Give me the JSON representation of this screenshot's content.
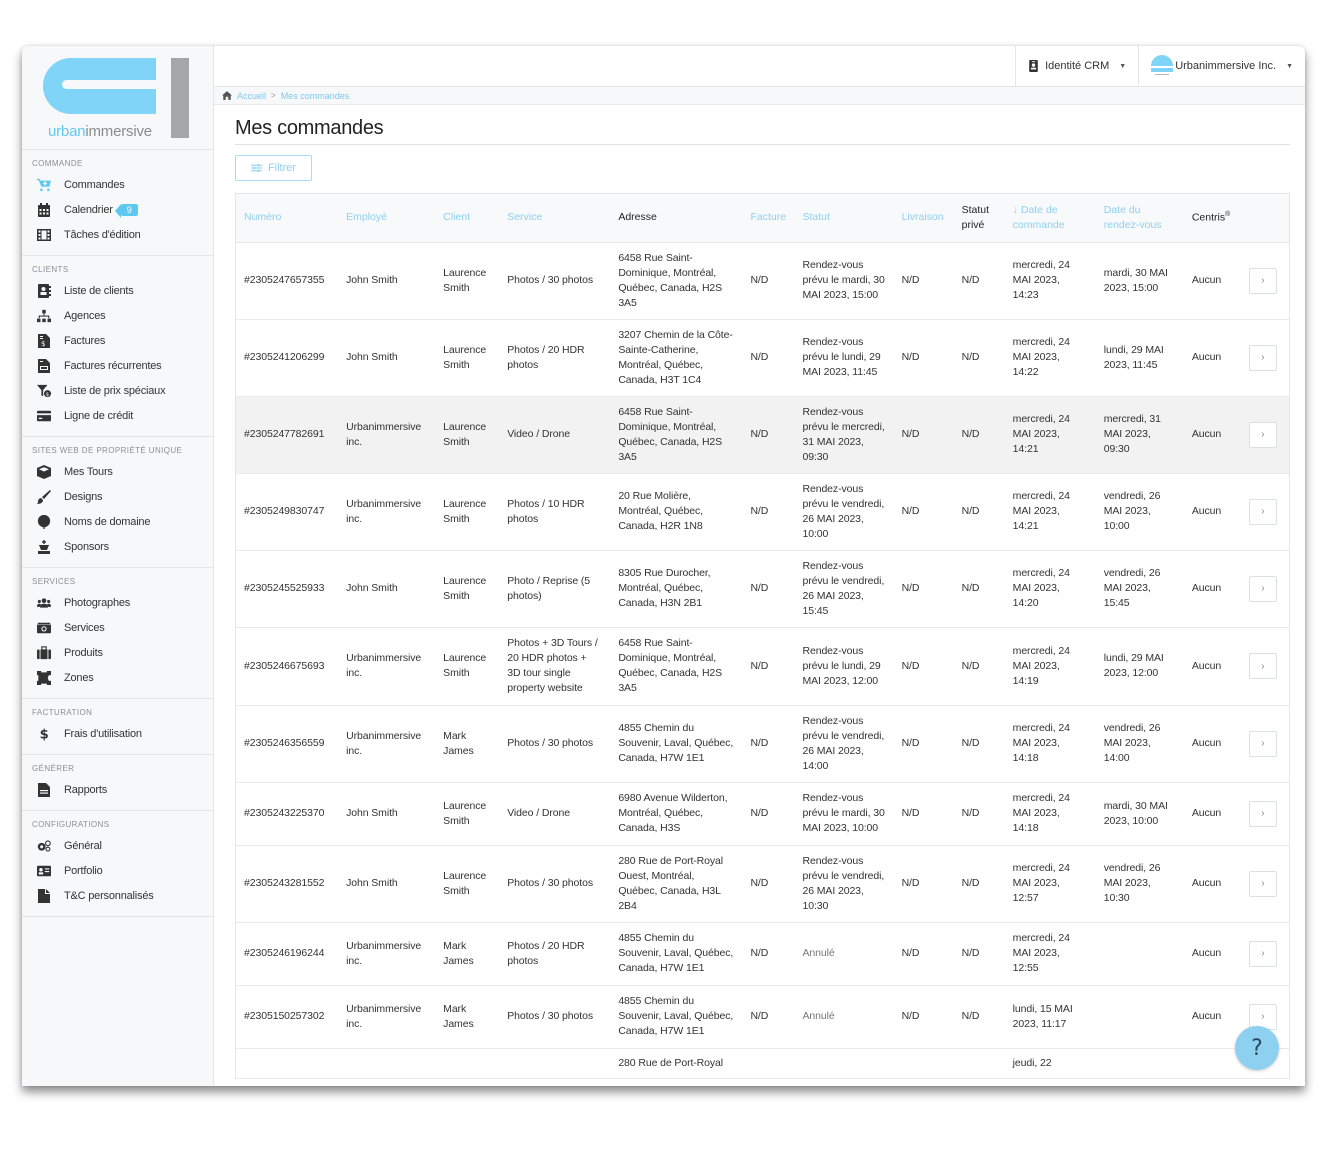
{
  "brand": {
    "word_blue": "urban",
    "word_gray": "immersive"
  },
  "topbar": {
    "crm_label": "Identité CRM",
    "account_label": "Urbanimmersive Inc."
  },
  "breadcrumb": {
    "home": "Accueil",
    "separator": ">",
    "current": "Mes commandes"
  },
  "page": {
    "title": "Mes commandes",
    "filter_label": "Filtrer"
  },
  "colors": {
    "accent": "#5ec8f0",
    "logo_blue": "#7fd4f7",
    "logo_gray": "#a5a6a8",
    "header_link": "#8ed0ef"
  },
  "sidebar": {
    "sections": [
      {
        "title": "Commande",
        "items": [
          {
            "label": "Commandes",
            "icon": "cart-icon",
            "active": true
          },
          {
            "label": "Calendrier",
            "icon": "calendar-icon",
            "badge": "9"
          },
          {
            "label": "Tâches d'édition",
            "icon": "film-icon"
          }
        ]
      },
      {
        "title": "Clients",
        "items": [
          {
            "label": "Liste de clients",
            "icon": "address-book-icon"
          },
          {
            "label": "Agences",
            "icon": "sitemap-icon"
          },
          {
            "label": "Factures",
            "icon": "invoice-icon"
          },
          {
            "label": "Factures récurrentes",
            "icon": "recurring-invoice-icon"
          },
          {
            "label": "Liste de prix spéciaux",
            "icon": "filter-dollar-icon"
          },
          {
            "label": "Ligne de crédit",
            "icon": "credit-card-icon"
          }
        ]
      },
      {
        "title": "Sites web de propriété unique",
        "items": [
          {
            "label": "Mes Tours",
            "icon": "cube-icon"
          },
          {
            "label": "Designs",
            "icon": "brush-icon"
          },
          {
            "label": "Noms de domaine",
            "icon": "podcast-icon"
          },
          {
            "label": "Sponsors",
            "icon": "chess-king-icon"
          }
        ]
      },
      {
        "title": "Services",
        "items": [
          {
            "label": "Photographes",
            "icon": "users-icon"
          },
          {
            "label": "Services",
            "icon": "camera-icon"
          },
          {
            "label": "Produits",
            "icon": "suitcase-icon"
          },
          {
            "label": "Zones",
            "icon": "draw-polygon-icon"
          }
        ]
      },
      {
        "title": "Facturation",
        "items": [
          {
            "label": "Frais d'utilisation",
            "icon": "dollar-icon"
          }
        ]
      },
      {
        "title": "Générer",
        "items": [
          {
            "label": "Rapports",
            "icon": "file-alt-icon"
          }
        ]
      },
      {
        "title": "Configurations",
        "items": [
          {
            "label": "Général",
            "icon": "cogs-icon"
          },
          {
            "label": "Portfolio",
            "icon": "id-card-icon"
          },
          {
            "label": "T&C personnalisés",
            "icon": "file-icon"
          }
        ]
      }
    ]
  },
  "table": {
    "columns": [
      {
        "label": "Numéro",
        "sortable": true
      },
      {
        "label": "Employé",
        "sortable": true
      },
      {
        "label": "Client",
        "sortable": true
      },
      {
        "label": "Service",
        "sortable": true
      },
      {
        "label": "Adresse",
        "sortable": false
      },
      {
        "label": "Facture",
        "sortable": true
      },
      {
        "label": "Statut",
        "sortable": true
      },
      {
        "label": "Livraison",
        "sortable": true
      },
      {
        "label": "Statut privé",
        "sortable": false
      },
      {
        "label": "Date de commande",
        "sortable": true,
        "sorted": "desc",
        "sort_icon": "↓"
      },
      {
        "label": "Date du rendez-vous",
        "sortable": true
      },
      {
        "label": "Centris",
        "sup": "®",
        "sortable": false
      },
      {
        "label": "",
        "sortable": false
      }
    ],
    "rows": [
      {
        "numero": "#2305247657355",
        "employe": "John Smith",
        "client": "Laurence Smith",
        "service": "Photos / 30 photos",
        "adresse": "6458 Rue Saint-Dominique, Montréal, Québec, Canada, H2S 3A5",
        "facture": "N/D",
        "statut": "Rendez-vous prévu le mardi, 30 MAI 2023, 15:00",
        "livraison": "N/D",
        "statut_prive": "N/D",
        "date_commande": "mercredi, 24 MAI 2023, 14:23",
        "date_rdv": "mardi, 30 MAI 2023, 15:00",
        "centris": "Aucun"
      },
      {
        "numero": "#2305241206299",
        "employe": "John Smith",
        "client": "Laurence Smith",
        "service": "Photos / 20 HDR photos",
        "adresse": "3207 Chemin de la Côte-Sainte-Catherine, Montréal, Québec, Canada, H3T 1C4",
        "facture": "N/D",
        "statut": "Rendez-vous prévu le lundi, 29 MAI 2023, 11:45",
        "livraison": "N/D",
        "statut_prive": "N/D",
        "date_commande": "mercredi, 24 MAI 2023, 14:22",
        "date_rdv": "lundi, 29 MAI 2023, 11:45",
        "centris": "Aucun"
      },
      {
        "numero": "#2305247782691",
        "employe": "Urbanimmersive inc.",
        "client": "Laurence Smith",
        "service": "Video / Drone",
        "adresse": "6458 Rue Saint-Dominique, Montréal, Québec, Canada, H2S 3A5",
        "facture": "N/D",
        "statut": "Rendez-vous prévu le mercredi, 31 MAI 2023, 09:30",
        "livraison": "N/D",
        "statut_prive": "N/D",
        "date_commande": "mercredi, 24 MAI 2023, 14:21",
        "date_rdv": "mercredi, 31 MAI 2023, 09:30",
        "centris": "Aucun",
        "highlight": true
      },
      {
        "numero": "#2305249830747",
        "employe": "Urbanimmersive inc.",
        "client": "Laurence Smith",
        "service": "Photos / 10 HDR photos",
        "adresse": "20 Rue Molière, Montréal, Québec, Canada, H2R 1N8",
        "facture": "N/D",
        "statut": "Rendez-vous prévu le vendredi, 26 MAI 2023, 10:00",
        "livraison": "N/D",
        "statut_prive": "N/D",
        "date_commande": "mercredi, 24 MAI 2023, 14:21",
        "date_rdv": "vendredi, 26 MAI 2023, 10:00",
        "centris": "Aucun"
      },
      {
        "numero": "#2305245525933",
        "employe": "John Smith",
        "client": "Laurence Smith",
        "service": "Photo / Reprise (5 photos)",
        "adresse": "8305 Rue Durocher, Montréal, Québec, Canada, H3N 2B1",
        "facture": "N/D",
        "statut": "Rendez-vous prévu le vendredi, 26 MAI 2023, 15:45",
        "livraison": "N/D",
        "statut_prive": "N/D",
        "date_commande": "mercredi, 24 MAI 2023, 14:20",
        "date_rdv": "vendredi, 26 MAI 2023, 15:45",
        "centris": "Aucun"
      },
      {
        "numero": "#2305246675693",
        "employe": "Urbanimmersive inc.",
        "client": "Laurence Smith",
        "service": "Photos + 3D Tours / 20 HDR photos + 3D tour single property website",
        "adresse": "6458 Rue Saint-Dominique, Montréal, Québec, Canada, H2S 3A5",
        "facture": "N/D",
        "statut": "Rendez-vous prévu le lundi, 29 MAI 2023, 12:00",
        "livraison": "N/D",
        "statut_prive": "N/D",
        "date_commande": "mercredi, 24 MAI 2023, 14:19",
        "date_rdv": "lundi, 29 MAI 2023, 12:00",
        "centris": "Aucun"
      },
      {
        "numero": "#2305246356559",
        "employe": "Urbanimmersive inc.",
        "client": "Mark James",
        "service": "Photos / 30 photos",
        "adresse": "4855 Chemin du Souvenir, Laval, Québec, Canada, H7W 1E1",
        "facture": "N/D",
        "statut": "Rendez-vous prévu le vendredi, 26 MAI 2023, 14:00",
        "livraison": "N/D",
        "statut_prive": "N/D",
        "date_commande": "mercredi, 24 MAI 2023, 14:18",
        "date_rdv": "vendredi, 26 MAI 2023, 14:00",
        "centris": "Aucun"
      },
      {
        "numero": "#2305243225370",
        "employe": "John Smith",
        "client": "Laurence Smith",
        "service": "Video / Drone",
        "adresse": "6980 Avenue Wilderton, Montréal, Québec, Canada, H3S",
        "facture": "N/D",
        "statut": "Rendez-vous prévu le mardi, 30 MAI 2023, 10:00",
        "livraison": "N/D",
        "statut_prive": "N/D",
        "date_commande": "mercredi, 24 MAI 2023, 14:18",
        "date_rdv": "mardi, 30 MAI 2023, 10:00",
        "centris": "Aucun"
      },
      {
        "numero": "#2305243281552",
        "employe": "John Smith",
        "client": "Laurence Smith",
        "service": "Photos / 30 photos",
        "adresse": "280 Rue de Port-Royal Ouest, Montréal, Québec, Canada, H3L 2B4",
        "facture": "N/D",
        "statut": "Rendez-vous prévu le vendredi, 26 MAI 2023, 10:30",
        "livraison": "N/D",
        "statut_prive": "N/D",
        "date_commande": "mercredi, 24 MAI 2023, 12:57",
        "date_rdv": "vendredi, 26 MAI 2023, 10:30",
        "centris": "Aucun"
      },
      {
        "numero": "#2305246196244",
        "employe": "Urbanimmersive inc.",
        "client": "Mark James",
        "service": "Photos / 20 HDR photos",
        "adresse": "4855 Chemin du Souvenir, Laval, Québec, Canada, H7W 1E1",
        "facture": "N/D",
        "statut": "Annulé",
        "livraison": "N/D",
        "statut_prive": "N/D",
        "date_commande": "mercredi, 24 MAI 2023, 12:55",
        "date_rdv": "",
        "centris": "Aucun",
        "cancelled": true
      },
      {
        "numero": "#2305150257302",
        "employe": "Urbanimmersive inc.",
        "client": "Mark James",
        "service": "Photos / 30 photos",
        "adresse": "4855 Chemin du Souvenir, Laval, Québec, Canada, H7W 1E1",
        "facture": "N/D",
        "statut": "Annulé",
        "livraison": "N/D",
        "statut_prive": "N/D",
        "date_commande": "lundi, 15 MAI 2023, 11:17",
        "date_rdv": "",
        "centris": "Aucun",
        "cancelled": true
      },
      {
        "numero": "",
        "employe": "",
        "client": "",
        "service": "",
        "adresse": "280 Rue de Port-Royal",
        "facture": "",
        "statut": "",
        "livraison": "",
        "statut_prive": "",
        "date_commande": "jeudi, 22",
        "date_rdv": "",
        "centris": "",
        "partial": true
      }
    ]
  },
  "help": {
    "label": "?"
  }
}
